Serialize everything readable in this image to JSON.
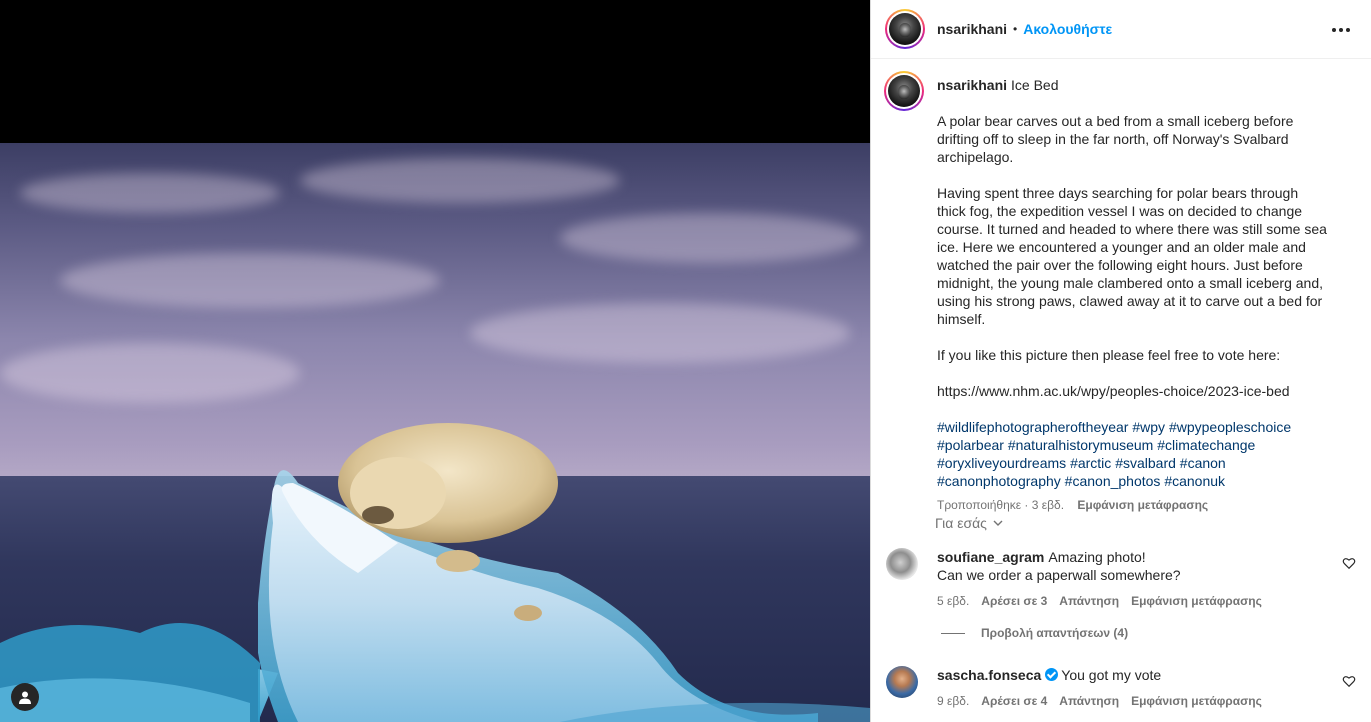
{
  "post": {
    "username": "nsarikhani",
    "follow_label": "Ακολουθήστε",
    "separator": "•"
  },
  "caption": {
    "username": "nsarikhani",
    "title": "Ice Bed",
    "para1": "A polar bear carves out a bed from a small iceberg before drifting off to sleep in the far north, off Norway's Svalbard archipelago.",
    "para2": "Having spent three days searching for polar bears through thick fog, the expedition vessel I was on decided to change course. It turned and headed to where there was still some sea ice. Here we encountered a younger and an older male and watched the pair over the following eight hours. Just before midnight, the young male clambered onto a small iceberg and, using his strong paws, clawed away at it to carve out a bed for himself.",
    "para3": "If you like this picture then please feel free to vote here:",
    "link": "https://www.nhm.ac.uk/wpy/peoples-choice/2023-ice-bed",
    "hashtags": [
      "#wildlifephotographeroftheyear",
      "#wpy",
      "#wpypeopleschoice",
      "#polarbear",
      "#naturalhistorymuseum",
      "#climatechange",
      "#oryxliveyourdreams",
      "#arctic",
      "#svalbard",
      "#canon",
      "#canonphotography",
      "#canon_photos",
      "#canonuk"
    ],
    "edited": "Τροποποιήθηκε · 3 εβδ.",
    "translate": "Εμφάνιση μετάφρασης"
  },
  "for_you": "Για εσάς",
  "comments": [
    {
      "username": "soufiane_agram",
      "text": "Amazing photo!\nCan we order a paperwall somewhere?",
      "time": "5 εβδ.",
      "likes": "Αρέσει σε 3",
      "reply": "Απάντηση",
      "translate": "Εμφάνιση μετάφρασης",
      "view_replies": "Προβολή απαντήσεων (4)"
    },
    {
      "username": "sascha.fonseca",
      "verified": true,
      "text": "You got my vote",
      "time": "9 εβδ.",
      "likes": "Αρέσει σε 4",
      "reply": "Απάντηση",
      "translate": "Εμφάνιση μετάφρασης"
    }
  ],
  "colors": {
    "accent": "#0095f6",
    "hashtag": "#00376b",
    "muted": "#737373"
  }
}
